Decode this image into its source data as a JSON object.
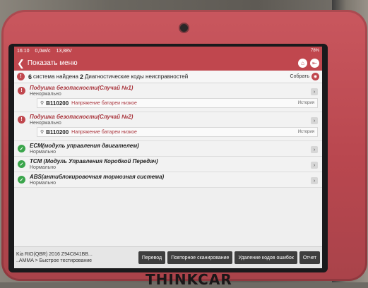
{
  "status_bar": {
    "time": "16:10",
    "network": "0,0кв/с",
    "voltage": "13,88V",
    "battery": "78%"
  },
  "header": {
    "title": "Показать меню"
  },
  "summary": {
    "systems_count": "6",
    "text_part1": "система найдена",
    "codes_count": "2",
    "text_part2": "Диагностические коды неисправностей",
    "collapse_label": "Собрать"
  },
  "systems": [
    {
      "title": "Подушка безопасности(Случай №1)",
      "status": "Ненормально",
      "kind": "error",
      "dtc": {
        "code": "B110200",
        "description": "Напряжение батареи низкое",
        "history": "История"
      }
    },
    {
      "title": "Подушка безопасности(Случай №2)",
      "status": "Ненормально",
      "kind": "error",
      "dtc": {
        "code": "B110200",
        "description": "Напряжение батареи низкое",
        "history": "История"
      }
    },
    {
      "title": "ECM(модуль управления двигателем)",
      "status": "Нормально",
      "kind": "ok"
    },
    {
      "title": "TCM (Модуль Управления Коробкой Передач)",
      "status": "Нормально",
      "kind": "ok"
    },
    {
      "title": "ABS(антиблокировочная тормозная система)",
      "status": "Нормально",
      "kind": "ok"
    }
  ],
  "bottom": {
    "vehicle_line1": "Kia RIO(QBR) 2016 Z94C841BB...",
    "vehicle_line2": "..AMMA > Быстрое тестирование",
    "buttons": {
      "translate": "Перевод",
      "rescan": "Повторное сканирование",
      "clear_codes": "Удаление кодов ошибок",
      "report": "Отчет"
    }
  },
  "device": {
    "brand": "THINKCAR"
  },
  "colors": {
    "accent": "#c0474e",
    "ok": "#3aa54b",
    "error_text": "#a8323a"
  }
}
